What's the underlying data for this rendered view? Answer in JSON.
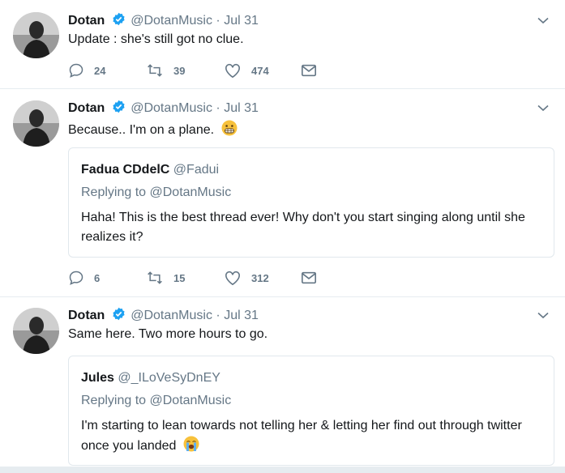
{
  "colors": {
    "accent": "#1da1f2",
    "muted": "#657786",
    "text": "#14171a",
    "border": "#e1e8ed"
  },
  "tweets": [
    {
      "name": "Dotan",
      "handle": "@DotanMusic",
      "dot": "·",
      "date": "Jul 31",
      "text": "Update : she's still got no clue.",
      "replies": "24",
      "retweets": "39",
      "likes": "474"
    },
    {
      "name": "Dotan",
      "handle": "@DotanMusic",
      "dot": "·",
      "date": "Jul 31",
      "text": "Because.. I'm on a plane.",
      "emoji": "grimacing-face-emoji",
      "quote": {
        "name": "Fadua CDdelC",
        "handle": "@Fadui",
        "replying": "Replying to @DotanMusic",
        "text": "Haha! This is the best thread ever! Why don't you start singing along until she realizes it?"
      },
      "replies": "6",
      "retweets": "15",
      "likes": "312"
    },
    {
      "name": "Dotan",
      "handle": "@DotanMusic",
      "dot": "·",
      "date": "Jul 31",
      "text": "Same here. Two more hours to go.",
      "quote": {
        "name": "Jules",
        "handle": "@_ILoVeSyDnEY",
        "replying": "Replying to @DotanMusic",
        "text": "I'm starting to lean towards not telling her & letting her find out through twitter once you landed",
        "emoji": "loudly-crying-face-emoji"
      }
    }
  ]
}
